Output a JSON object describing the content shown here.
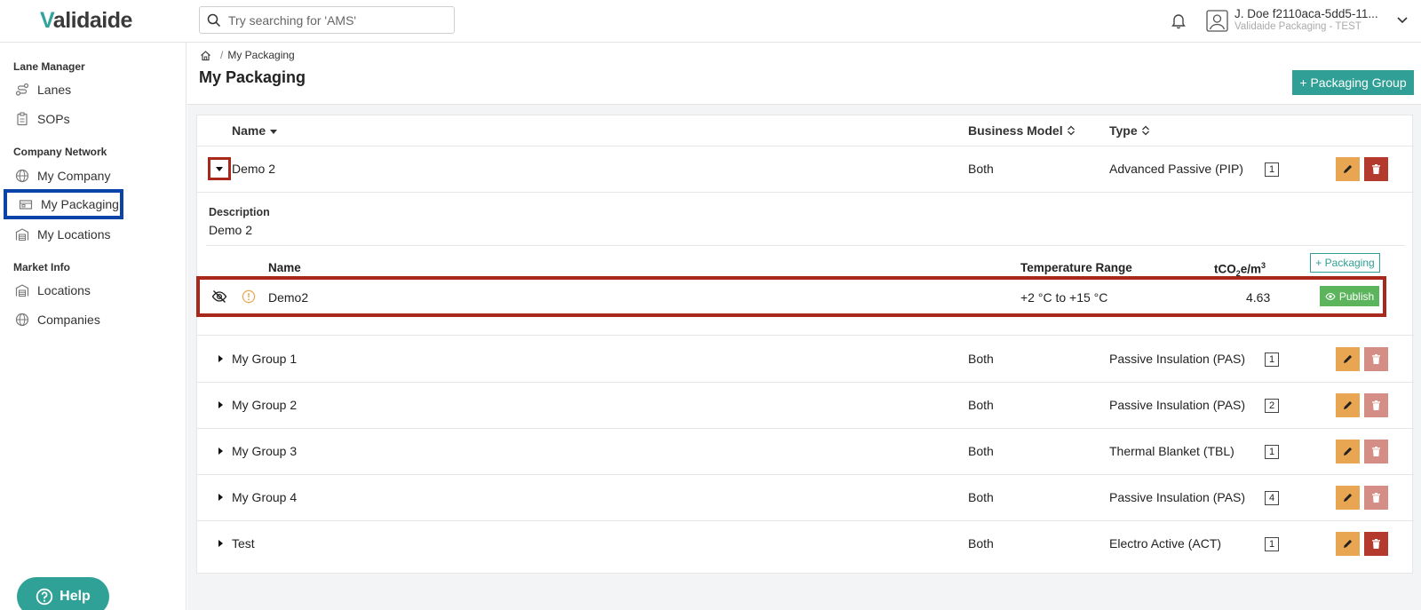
{
  "app": {
    "logo_text_accent": "V",
    "logo_text_rest": "alidaide"
  },
  "search": {
    "placeholder": "Try searching for 'AMS'"
  },
  "user": {
    "name": "J. Doe f2110aca-5dd5-11...",
    "company": "Validaide Packaging - TEST"
  },
  "sidebar": {
    "sections": [
      {
        "title": "Lane Manager",
        "items": [
          {
            "label": "Lanes",
            "icon": "route-icon"
          },
          {
            "label": "SOPs",
            "icon": "clipboard-icon"
          }
        ]
      },
      {
        "title": "Company Network",
        "items": [
          {
            "label": "My Company",
            "icon": "globe-icon"
          },
          {
            "label": "My Packaging",
            "icon": "package-icon",
            "active": true
          },
          {
            "label": "My Locations",
            "icon": "warehouse-icon"
          }
        ]
      },
      {
        "title": "Market Info",
        "items": [
          {
            "label": "Locations",
            "icon": "warehouse-icon"
          },
          {
            "label": "Companies",
            "icon": "globe-icon"
          }
        ]
      }
    ],
    "help_label": "Help"
  },
  "breadcrumb": {
    "current": "My Packaging"
  },
  "page": {
    "title": "My Packaging",
    "add_group_label": "+ Packaging Group"
  },
  "table": {
    "headers": {
      "name": "Name",
      "business_model": "Business Model",
      "type": "Type"
    },
    "expanded_group": {
      "name": "Demo 2",
      "business_model": "Both",
      "type": "Advanced Passive (PIP)",
      "count": "1",
      "description_label": "Description",
      "description": "Demo 2",
      "sub_headers": {
        "name": "Name",
        "temperature": "Temperature Range",
        "tco2_prefix": "tCO",
        "tco2_sub": "2",
        "tco2_suffix": "e/m",
        "tco2_sup": "3"
      },
      "add_packaging_label": "+ Packaging",
      "packaging": [
        {
          "name": "Demo2",
          "temperature": "+2 °C to +15 °C",
          "tco2": "4.63",
          "publish_label": "Publish"
        }
      ]
    },
    "groups": [
      {
        "name": "My Group 1",
        "business_model": "Both",
        "type": "Passive Insulation (PAS)",
        "count": "1",
        "delete_enabled": false
      },
      {
        "name": "My Group 2",
        "business_model": "Both",
        "type": "Passive Insulation (PAS)",
        "count": "2",
        "delete_enabled": false
      },
      {
        "name": "My Group 3",
        "business_model": "Both",
        "type": "Thermal Blanket (TBL)",
        "count": "1",
        "delete_enabled": false
      },
      {
        "name": "My Group 4",
        "business_model": "Both",
        "type": "Passive Insulation (PAS)",
        "count": "4",
        "delete_enabled": false
      },
      {
        "name": "Test",
        "business_model": "Both",
        "type": "Electro Active (ACT)",
        "count": "1",
        "delete_enabled": true
      }
    ]
  },
  "colors": {
    "accent": "#30a096",
    "edit": "#e9a652",
    "delete": "#b33a2d",
    "highlight": "#a8291b",
    "active_nav": "#0b44a8",
    "publish": "#5cb55c"
  }
}
